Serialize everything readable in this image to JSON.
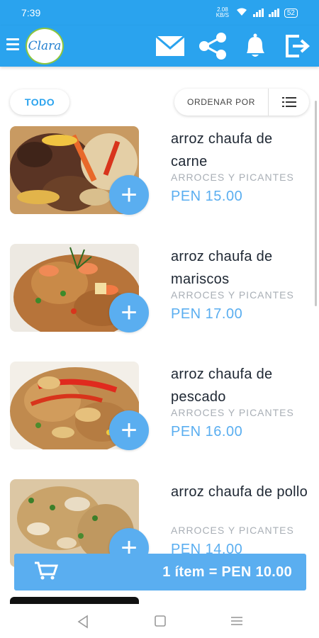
{
  "status_bar": {
    "time": "7:39",
    "data_speed": "2.08 KB/S",
    "battery": "52"
  },
  "app_bar": {
    "logo_text": "Clara",
    "icons": [
      "menu-icon",
      "mail-icon",
      "share-icon",
      "bell-icon",
      "logout-icon"
    ]
  },
  "filters": {
    "category_chip": "TODO",
    "sort_label": "ORDENAR POR",
    "view_toggle_icon": "list-icon"
  },
  "items": [
    {
      "name": "arroz chaufa de carne",
      "category": "ARROCES Y PICANTES",
      "price": "PEN 15.00",
      "add_label": "+"
    },
    {
      "name": "arroz chaufa de mariscos",
      "category": "ARROCES Y PICANTES",
      "price": "PEN 17.00",
      "add_label": "+"
    },
    {
      "name": "arroz chaufa de pescado",
      "category": "ARROCES Y PICANTES",
      "price": "PEN 16.00",
      "add_label": "+"
    },
    {
      "name": "arroz chaufa de pollo",
      "category": "ARROCES Y PICANTES",
      "price": "PEN 14.00",
      "add_label": "+"
    }
  ],
  "cart": {
    "summary": "1 ítem = PEN 10.00",
    "icon": "cart-icon"
  },
  "colors": {
    "primary": "#2aa3ee",
    "accent": "#5aaef0",
    "muted": "#a9afb6"
  }
}
